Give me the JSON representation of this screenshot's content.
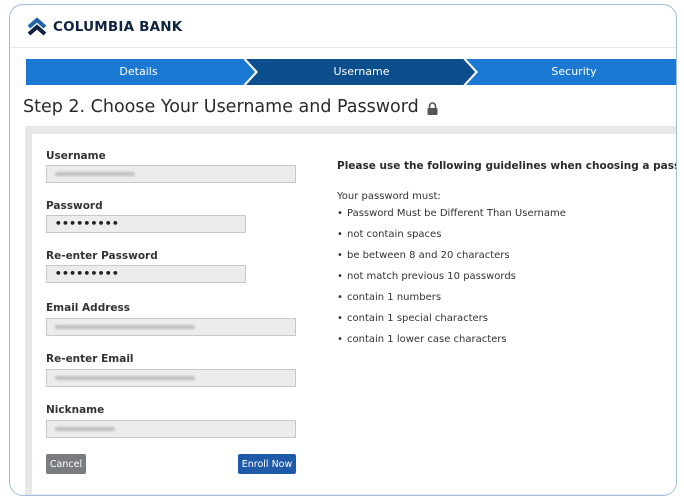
{
  "brand": {
    "name": "COLUMBIA BANK"
  },
  "steps": [
    {
      "label": "Details"
    },
    {
      "label": "Username"
    },
    {
      "label": "Security"
    }
  ],
  "page": {
    "title": "Step 2. Choose Your Username and Password"
  },
  "form": {
    "username_label": "Username",
    "password_label": "Password",
    "password_value": "•••••••••",
    "reenter_password_label": "Re-enter Password",
    "reenter_password_value": "•••••••••",
    "email_label": "Email Address",
    "reenter_email_label": "Re-enter Email",
    "nickname_label": "Nickname",
    "cancel_label": "Cancel",
    "enroll_label": "Enroll Now"
  },
  "guidelines": {
    "title": "Please use the following guidelines when choosing a password.",
    "subtitle": "Your password must:",
    "rules": [
      "Password Must be Different Than Username",
      "not contain spaces",
      "be between 8 and 20 characters",
      "not match previous 10 passwords",
      "contain 1 numbers",
      "contain 1 special characters",
      "contain 1 lower case characters"
    ]
  },
  "colors": {
    "step_active": "#0d4e8c",
    "step_inactive": "#1b79d4",
    "logo": "#1f63a8",
    "enroll_button": "#1f5aa8",
    "cancel_button": "#7a7d80"
  },
  "icons": [
    "columbia-logo-icon",
    "lock-icon"
  ]
}
